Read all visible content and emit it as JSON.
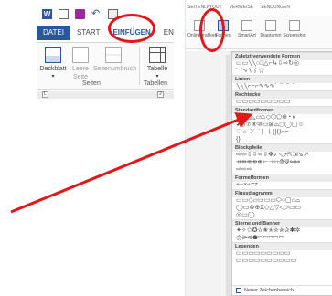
{
  "left_ribbon": {
    "qat_word_letter": "W",
    "tabs": [
      "DATEI",
      "START",
      "EINFÜGEN",
      "ENT"
    ],
    "buttons": {
      "deckblatt": "Deckblatt",
      "leere_seite": "Leere Seite",
      "seitenumbruch": "Seitenumbruch",
      "tabelle": "Tabelle"
    },
    "groups": {
      "seiten": "Seiten",
      "tabellen": "Tabellen"
    },
    "mini_box_1": "L",
    "mini_box_2": "2"
  },
  "right_ribbon": {
    "tabs": [
      "SEITENLAYOUT",
      "VERWEISE",
      "SENDUNGEN"
    ],
    "icons": {
      "onlinegrafiken": "Onlinegrafiken",
      "formen": "Formen",
      "smartart": "SmartArt",
      "diagramm": "Diagramm",
      "screenshot": "Screenshot"
    }
  },
  "shapes_panel": {
    "sections": {
      "recent": "Zuletzt verwendete Formen",
      "lines": "Linien",
      "rectangles": "Rechtecke",
      "basic": "Standardformen",
      "block_arrows": "Blockpfeile",
      "equation": "Formelformen",
      "flowchart": "Flussdiagramm",
      "stars": "Sterne und Banner",
      "callouts": "Legenden"
    },
    "rows": {
      "recent_1": "▭▭╲╲○□△⌐↳⇩⇨↻◎",
      "recent_2": "⌒∿∖⌇☆",
      "lines": "╲╲╲⌐⌐⌐∿∿∿⌒⌒⌒",
      "rectangles": "▭▭▭▭▭▭▭▭▭",
      "basic_1": "▭○△◺▱⏢◇⬡⬠⊕◔◑",
      "basic_2": "◕◶⑦⑧⑩▭⊠⌓◻◯▢☺",
      "basic_3": "♡☼☽⌒⎰⎱{}()⌐⌐",
      "basic_4": "{}",
      "block_1": "⇨⇦⇧⇩⬄⇳✥⤺⤻⇱⇲⇘⇗",
      "block_2": "⇸⇹⇺⇻⇼⇽⇾⇿⟰⟱⤆⤇",
      "block_3": "⇨⇨⇨",
      "equation": "+−×÷=≠",
      "flow_1": "▭▭◇▱▭▭▭⬭○▢⌂⌓",
      "flow_2": "◯▭⊗⊕⧖◇△▽◁▷▭▭",
      "flow_3": "◎▭◯",
      "stars_1": "✦✧✩✪✫✬✭✮✯✰✱✲",
      "stars_2": "⚝⚞⚟⬟▭▭▭▭▭",
      "callouts_1": "▭▭▭▭▭▭▭▭▭",
      "callouts_2": "▭▭▭▭▭▭▭▭▭▭"
    },
    "footer": "Neuer Zeichenbereich"
  },
  "annotation_color": "#e3161a",
  "accent_color": "#2b579a"
}
